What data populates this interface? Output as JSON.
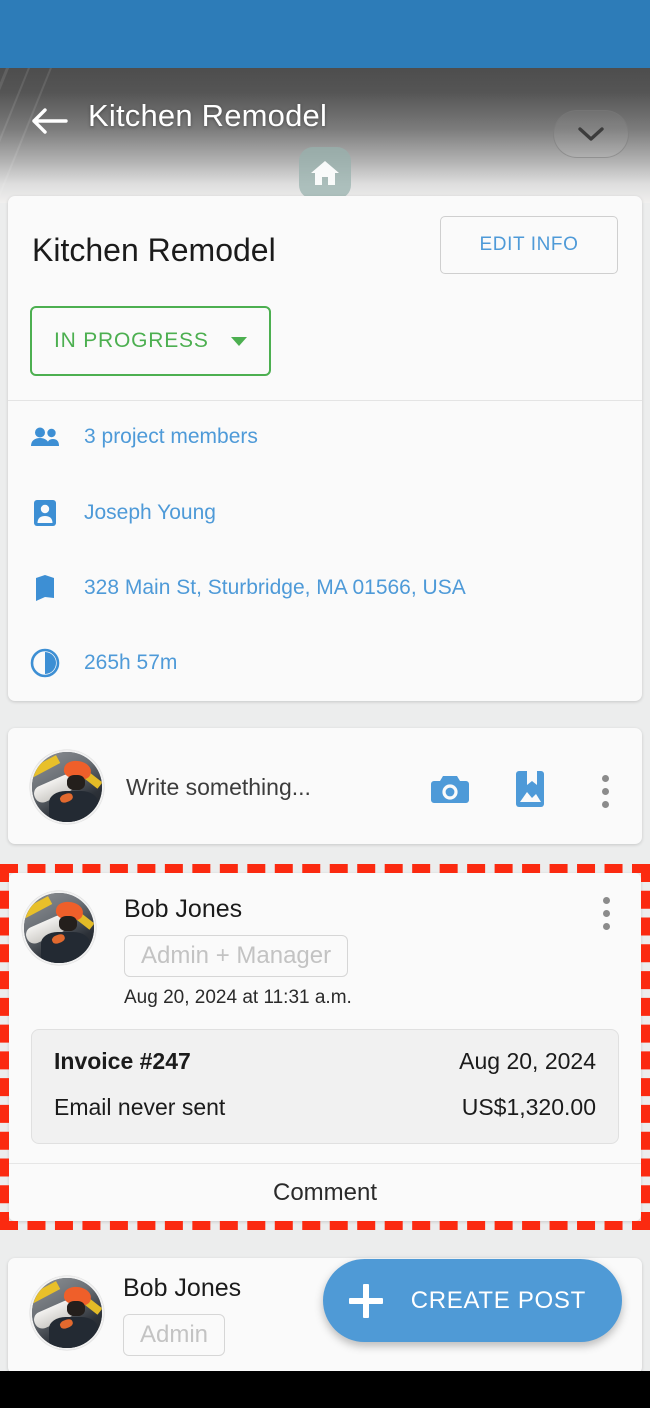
{
  "app": {
    "status_bar_color": "#2d7cb8",
    "accent_blue": "#4e9ad8",
    "accent_green": "#4caf50",
    "highlight_color": "#fb2a10"
  },
  "appbar": {
    "back_icon": "arrow-left-icon",
    "title": "Kitchen Remodel",
    "expand_icon": "chevron-down-icon",
    "home_icon": "home-icon"
  },
  "project": {
    "title": "Kitchen Remodel",
    "edit_button": "EDIT INFO",
    "status": "IN PROGRESS",
    "info_rows": [
      {
        "icon": "people-icon",
        "text": "3 project members"
      },
      {
        "icon": "contact-card-icon",
        "text": "Joseph Young"
      },
      {
        "icon": "map-icon",
        "text": "328 Main St, Sturbridge, MA 01566, USA"
      },
      {
        "icon": "time-pie-icon",
        "text": "265h 57m"
      }
    ]
  },
  "composer": {
    "avatar": "user-avatar",
    "placeholder": "Write something...",
    "camera_icon": "camera-icon",
    "photo_bookmark_icon": "photo-bookmark-icon",
    "more_icon": "kebab-menu-icon"
  },
  "highlighted_post": {
    "avatar": "user-avatar",
    "author": "Bob Jones",
    "role": "Admin + Manager",
    "timestamp": "Aug 20, 2024 at 11:31 a.m.",
    "more_icon": "kebab-menu-icon",
    "invoice": {
      "title": "Invoice #247",
      "date": "Aug 20, 2024",
      "status": "Email never sent",
      "amount": "US$1,320.00"
    },
    "comment_button": "Comment"
  },
  "next_post": {
    "avatar": "user-avatar",
    "author": "Bob Jones",
    "role": "Admin"
  },
  "fab": {
    "icon": "plus-icon",
    "label": "CREATE POST"
  }
}
